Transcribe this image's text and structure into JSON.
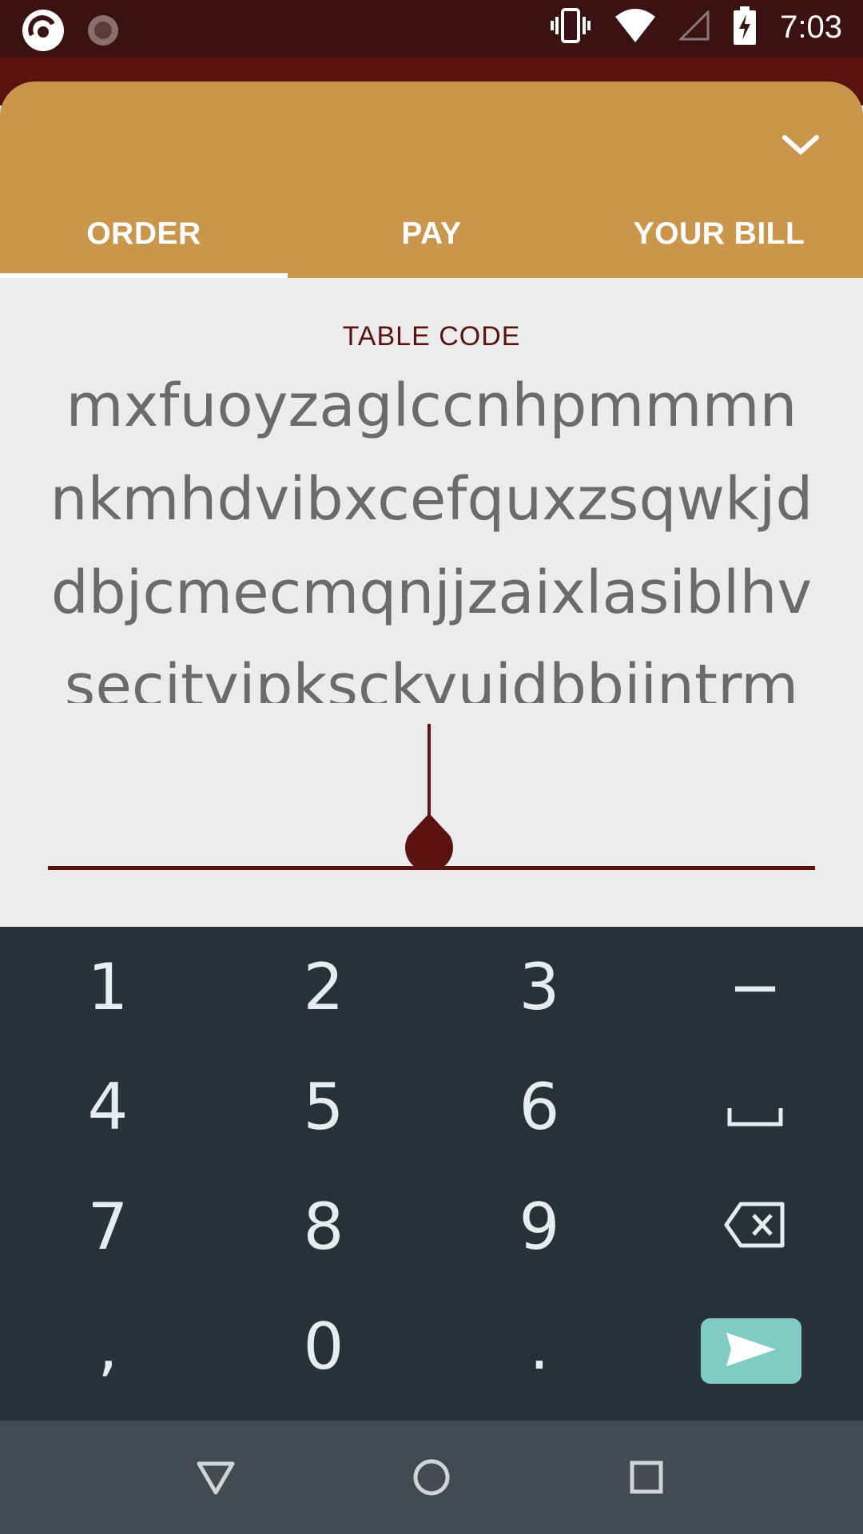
{
  "status_bar": {
    "time": "7:03",
    "icons": [
      "app-logo-icon",
      "loading-icon",
      "vibrate-icon",
      "wifi-icon",
      "cell-signal-icon",
      "battery-charging-icon"
    ]
  },
  "tabs": [
    {
      "label": "ORDER",
      "active": true
    },
    {
      "label": "PAY",
      "active": false
    },
    {
      "label": "YOUR BILL",
      "active": false
    }
  ],
  "field": {
    "label": "TABLE CODE",
    "value": "mxfuoyzaglccnhpmmmnnkmhdvibxcefquxzsqwkjddbjcmecmqnjjzaixlasiblhvsecjtyjpksckyuidbbiintrmhqsojtzggkurpfndkvsettzmawmmcigrcidukrhisdlphfilqq"
  },
  "keyboard": {
    "keys": [
      "1",
      "2",
      "3",
      "−",
      "4",
      "5",
      "6",
      "␣",
      "7",
      "8",
      "9",
      "backspace",
      ",",
      "0",
      ".",
      "send"
    ]
  },
  "colors": {
    "status_bar": "#3b1212",
    "header": "#c9964b",
    "accent": "#5a1311",
    "keyboard_bg": "#263238",
    "send_button": "#80cbc4",
    "nav_bar": "#434a50"
  }
}
